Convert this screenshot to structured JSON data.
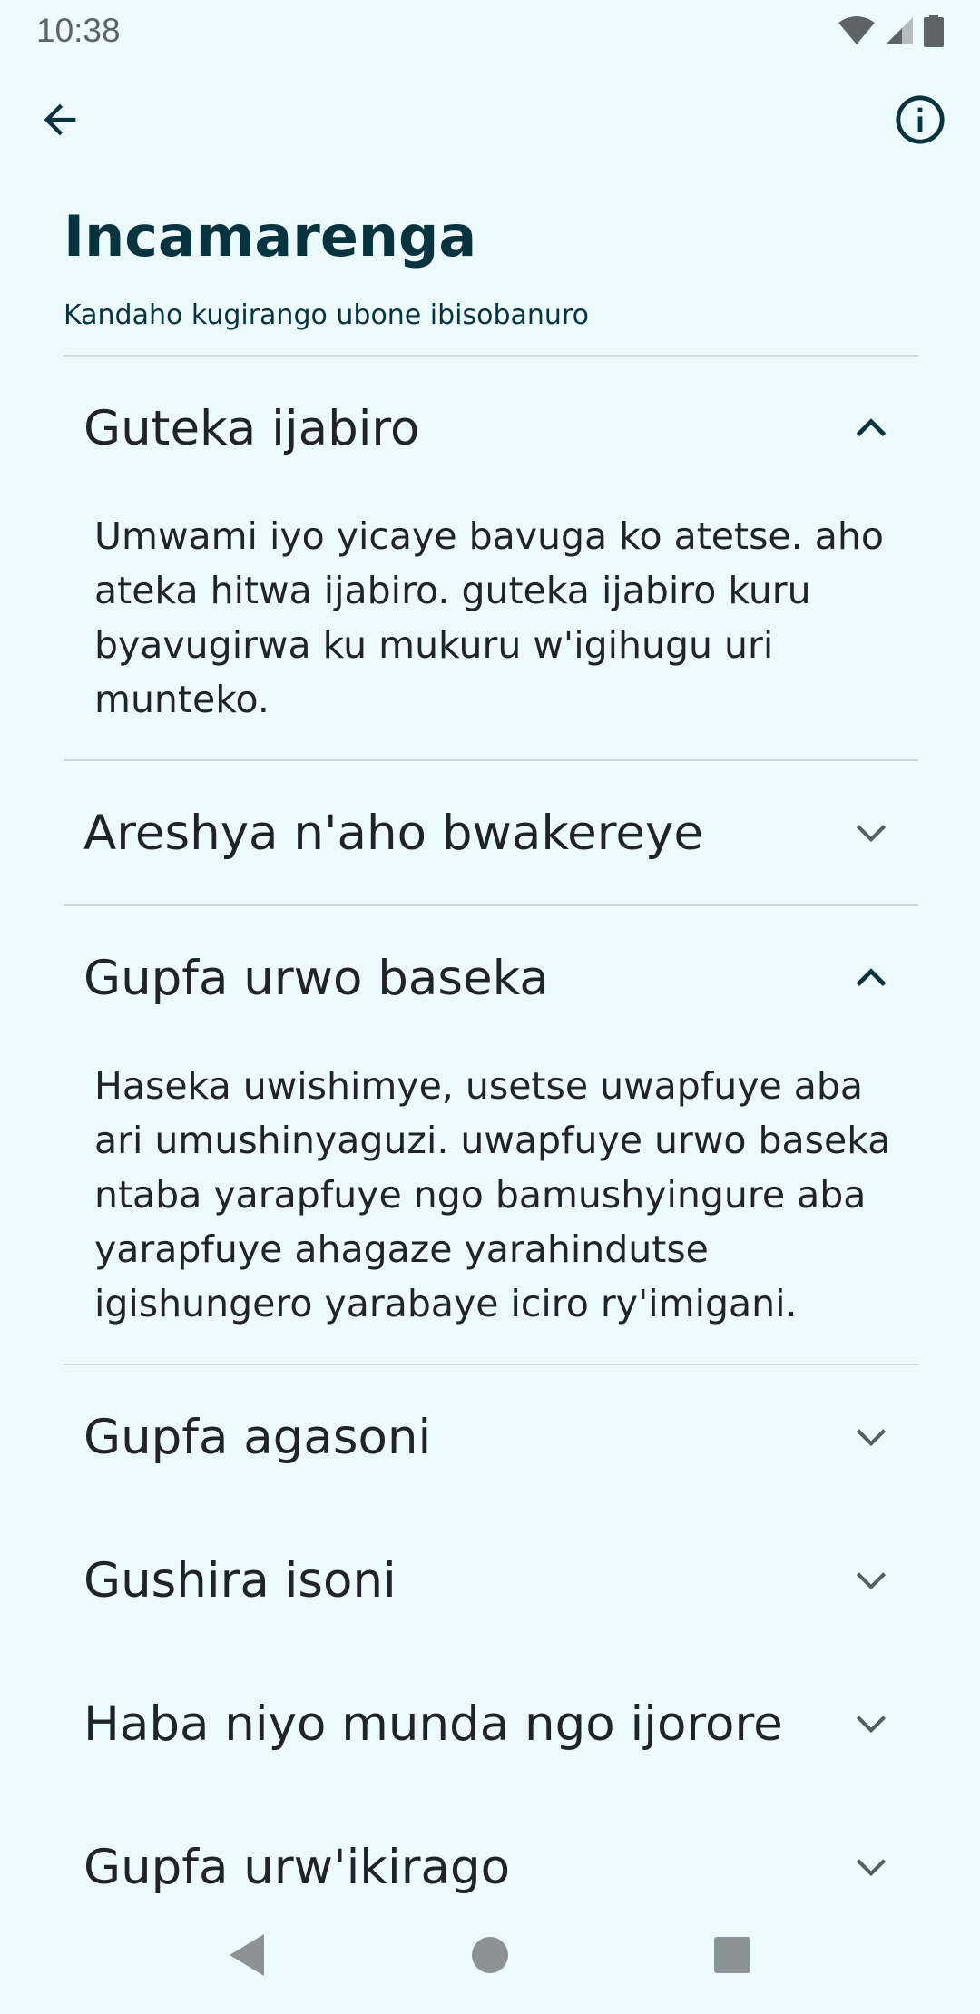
{
  "status_bar": {
    "time": "10:38"
  },
  "header": {
    "title": "Incamarenga",
    "subtitle": "Kandaho kugirango ubone ibisobanuro"
  },
  "items": [
    {
      "title": "Guteka ijabiro",
      "expanded": true,
      "body": "Umwami iyo yicaye bavuga ko atetse. aho ateka hitwa ijabiro. guteka ijabiro kuru byavugirwa ku mukuru w'igihugu uri munteko."
    },
    {
      "title": "Areshya n'aho bwakereye",
      "expanded": false
    },
    {
      "title": "Gupfa urwo baseka",
      "expanded": true,
      "body": "Haseka uwishimye, usetse uwapfuye aba ari umushinyaguzi. uwapfuye urwo baseka ntaba yarapfuye ngo bamushyingure aba yarapfuye ahagaze yarahindutse igishungero yarabaye iciro ry'imigani."
    },
    {
      "title": "Gupfa agasoni",
      "expanded": false
    },
    {
      "title": "Gushira isoni",
      "expanded": false
    },
    {
      "title": "Haba niyo munda ngo ijorore",
      "expanded": false
    },
    {
      "title": "Gupfa urw'ikirago",
      "expanded": false
    }
  ],
  "icons": {
    "back": "arrow-left-icon",
    "info": "info-icon",
    "expanded": "chevron-up-icon",
    "collapsed": "chevron-down-icon"
  },
  "colors": {
    "background": "#ECFAFE",
    "title": "#06343E",
    "divider": "#CCD9DD",
    "icon": "#06343E"
  }
}
